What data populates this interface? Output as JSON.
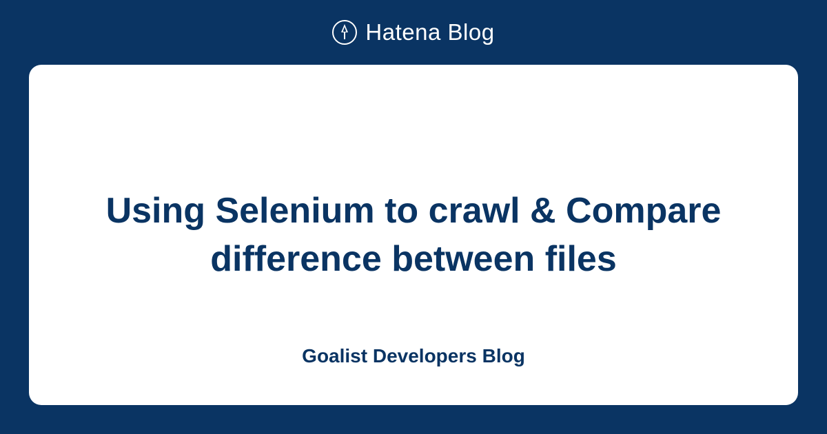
{
  "header": {
    "brand": "Hatena Blog"
  },
  "card": {
    "title": "Using Selenium to crawl & Compare difference between files",
    "blog_name": "Goalist Developers Blog"
  }
}
